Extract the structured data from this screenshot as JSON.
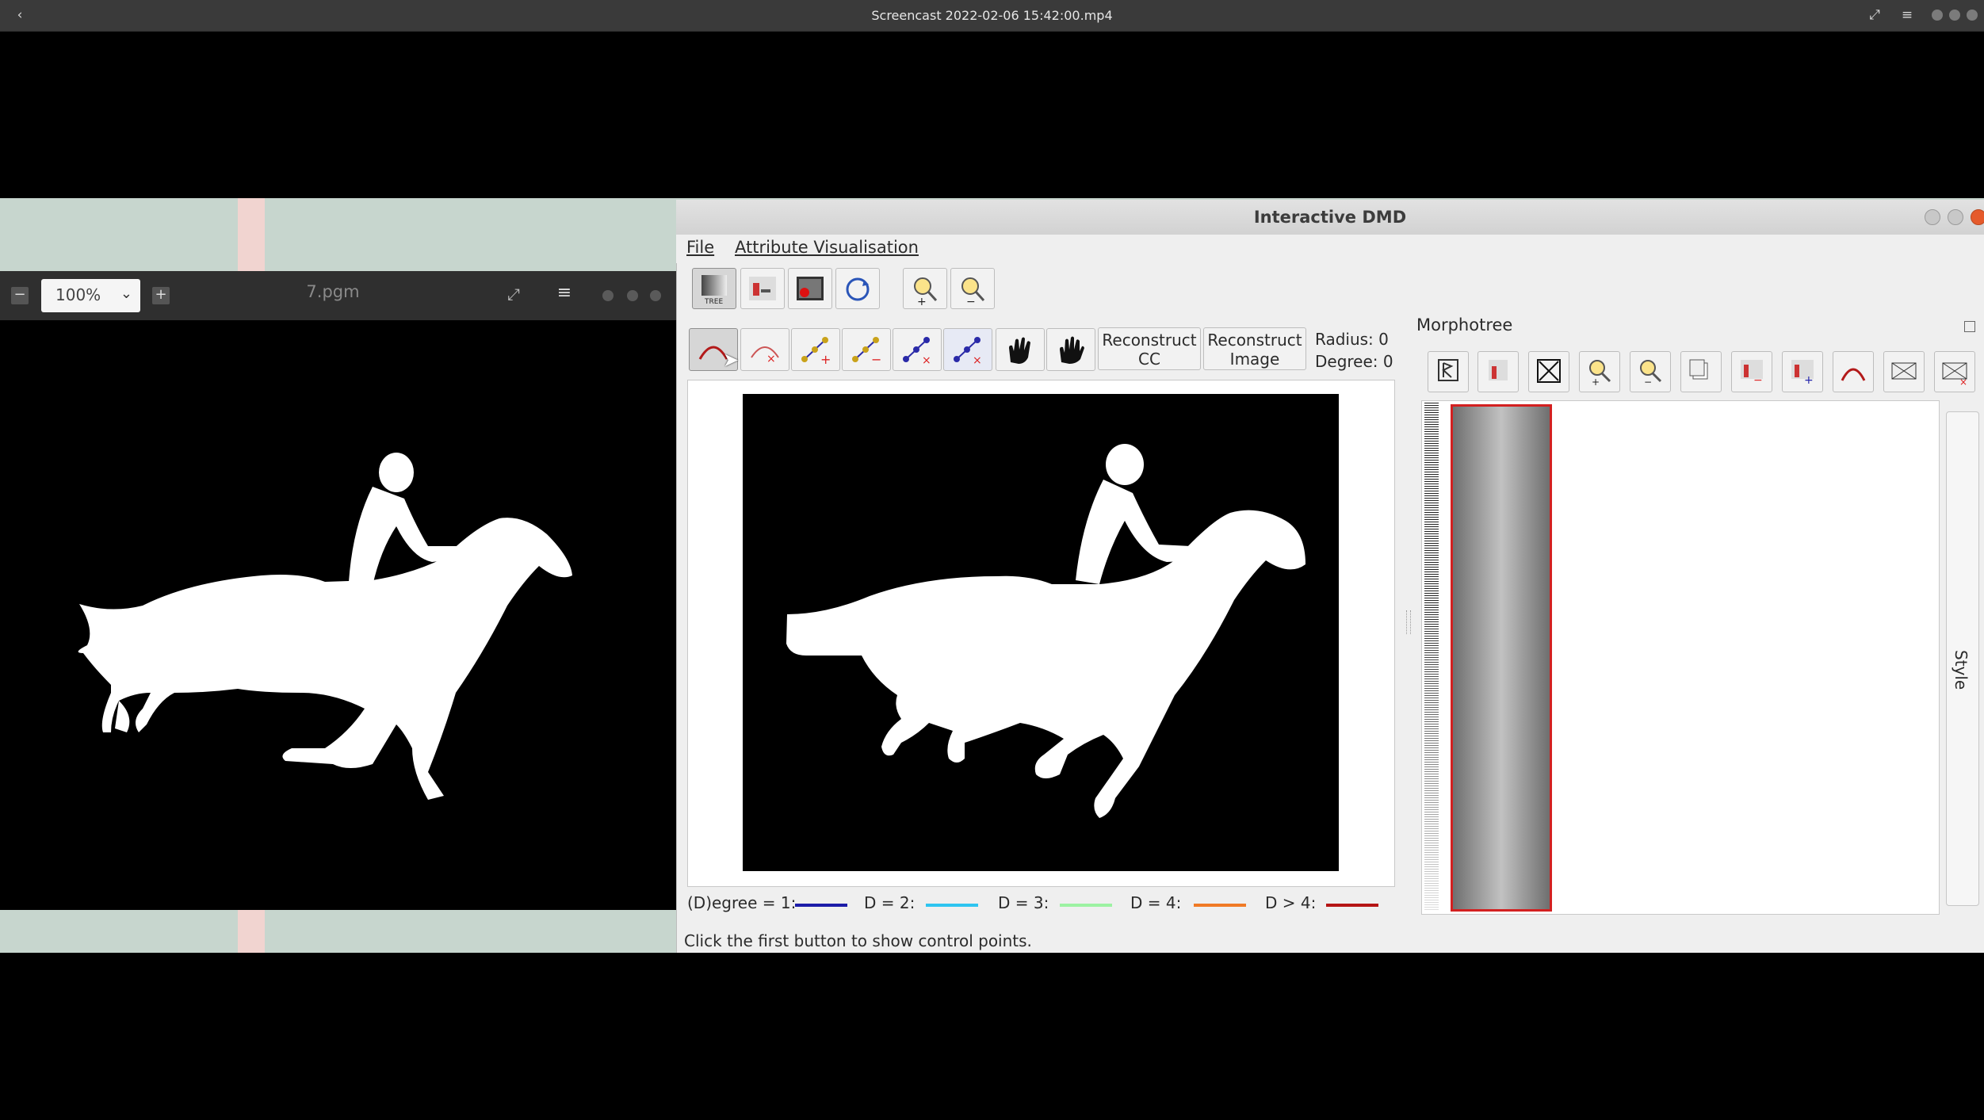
{
  "player": {
    "title": "Screencast 2022-02-06 15:42:00.mp4",
    "back_icon": "chevron-left-icon",
    "fullscreen_icon": "fullscreen-icon",
    "menu_icon": "hamburger-menu-icon"
  },
  "viewer": {
    "zoom_value": "100%",
    "file_title": "7.pgm"
  },
  "dmd": {
    "window_title": "Interactive DMD",
    "menus": {
      "file": "File",
      "attribute": "Attribute Visualisation"
    },
    "buttons": {
      "reconstruct_cc_line1": "Reconstruct",
      "reconstruct_cc_line2": "CC",
      "reconstruct_image_line1": "Reconstruct",
      "reconstruct_image_line2": "Image"
    },
    "info": {
      "radius": "Radius: 0",
      "degree": "Degree: 0"
    },
    "legend": [
      {
        "label": "(D)egree = 1:",
        "color": "#1c1ca8"
      },
      {
        "label": "D = 2:",
        "color": "#2ec4f0"
      },
      {
        "label": "D = 3:",
        "color": "#9cf2a2"
      },
      {
        "label": "D = 4:",
        "color": "#f07a26"
      },
      {
        "label": "D > 4:",
        "color": "#b51515"
      }
    ],
    "status": "Click the first button to show control points."
  },
  "morphotree": {
    "title": "Morphotree",
    "style_tab": "Style",
    "selected_border_color": "#d32020"
  }
}
